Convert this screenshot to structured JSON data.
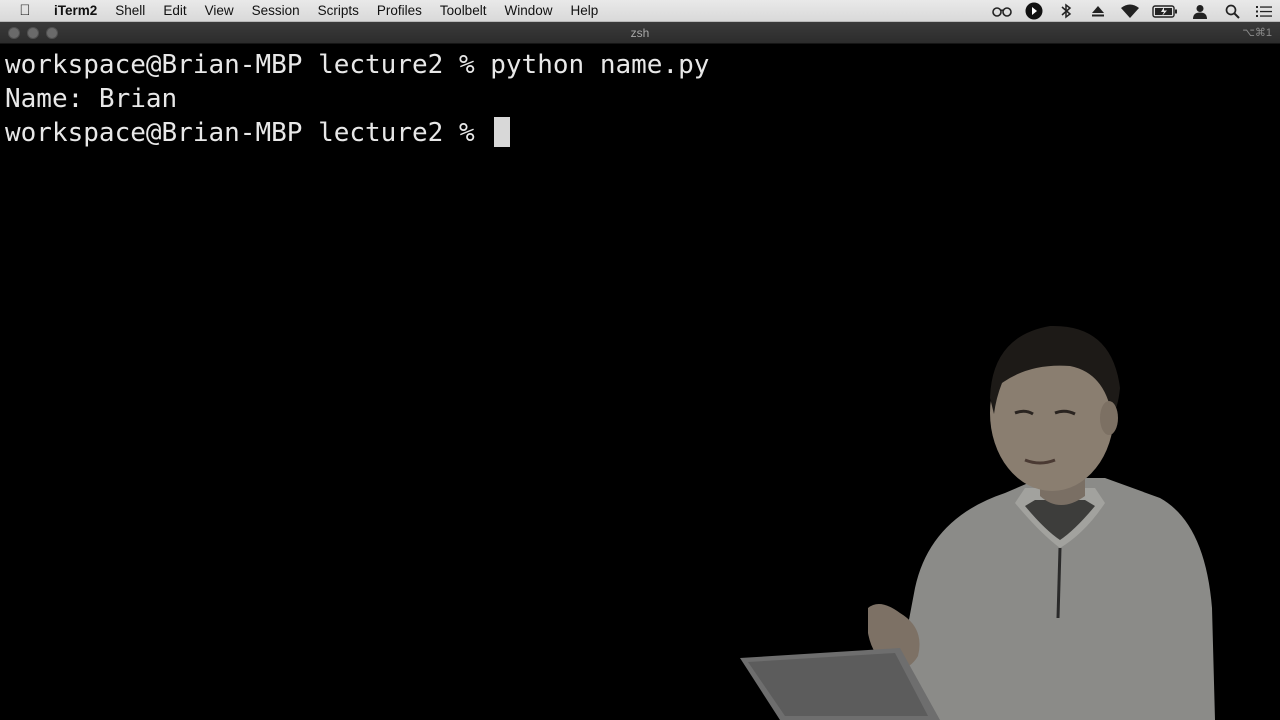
{
  "menubar": {
    "app_name": "iTerm2",
    "items": [
      "Shell",
      "Edit",
      "View",
      "Session",
      "Scripts",
      "Profiles",
      "Toolbelt",
      "Window",
      "Help"
    ],
    "status_icons": [
      "glasses-icon",
      "play-icon",
      "bluetooth-icon",
      "eject-icon",
      "wifi-icon",
      "battery-icon",
      "user-icon",
      "search-icon",
      "list-icon"
    ]
  },
  "window": {
    "title": "zsh",
    "shortcut": "⌥⌘1"
  },
  "terminal": {
    "lines": [
      "workspace@Brian-MBP lecture2 % python name.py",
      "Name: Brian",
      "workspace@Brian-MBP lecture2 % "
    ]
  }
}
